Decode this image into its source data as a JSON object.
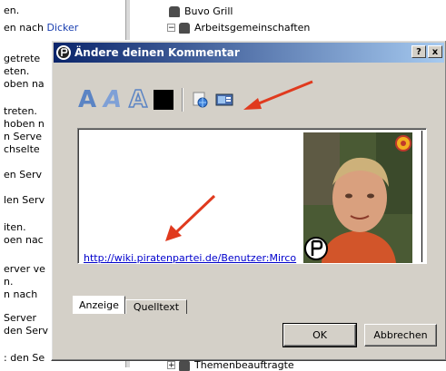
{
  "background": {
    "log_lines": [
      {
        "text": "en.",
        "link": ""
      },
      {
        "text": "en nach ",
        "link": "Dicker"
      },
      {
        "text": "getrete",
        "link": ""
      },
      {
        "text": "eten.",
        "link": ""
      },
      {
        "text": "oben na",
        "link": ""
      },
      {
        "text": "treten.",
        "link": ""
      },
      {
        "text": "hoben n",
        "link": ""
      },
      {
        "text": "n Serve",
        "link": ""
      },
      {
        "text": "chselte",
        "link": ""
      },
      {
        "text": "en Serv",
        "link": ""
      },
      {
        "text": "len Serv",
        "link": ""
      },
      {
        "text": "iten.",
        "link": ""
      },
      {
        "text": "oen nac",
        "link": ""
      },
      {
        "text": "erver ve",
        "link": ""
      },
      {
        "text": "n.",
        "link": ""
      },
      {
        "text": "n nach",
        "link": ""
      },
      {
        "text": "Server",
        "link": ""
      },
      {
        "text": "den Serv",
        "link": ""
      },
      {
        "text": ": den Se",
        "link": ""
      }
    ],
    "tree": {
      "top_item": "Buvo Grill",
      "item_2": "Arbeitsgemeinschaften",
      "bottom_item": "Themenbeauftragte"
    }
  },
  "dialog": {
    "title": "Ändere deinen Kommentar",
    "help_btn": "?",
    "close_btn": "x",
    "toolbar": {
      "bold_label": "A",
      "italic_label": "A",
      "outline_label": "A"
    },
    "content": {
      "link_text": "http://wiki.piratenpartei.de/Benutzer:Mirco"
    },
    "tabs": [
      {
        "label": "Anzeige"
      },
      {
        "label": "Quelltext"
      }
    ],
    "ok_label": "OK",
    "cancel_label": "Abbrechen"
  },
  "colors": {
    "dialog_face": "#d4d0c8",
    "titlebar_start": "#0a246a",
    "titlebar_end": "#a6caf0",
    "annotation_arrow": "#e03a1e",
    "link": "#0000cc"
  }
}
